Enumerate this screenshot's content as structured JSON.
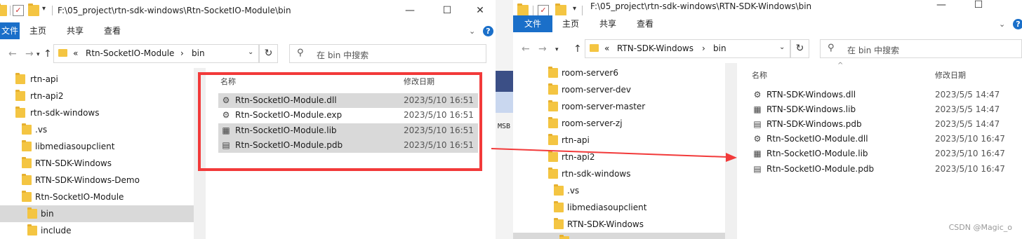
{
  "left_window": {
    "title_path": "F:\\05_project\\rtn-sdk-windows\\Rtn-SocketIO-Module\\bin",
    "controls": {
      "minimize": "—",
      "maximize": "☐",
      "close": "✕"
    },
    "ribbon": {
      "file_tab": "文件",
      "tabs": [
        "主页",
        "共享",
        "查看"
      ]
    },
    "address": {
      "prefix": "«",
      "crumbs": [
        "Rtn-SocketIO-Module",
        "bin"
      ]
    },
    "search_placeholder": "在 bin 中搜索",
    "tree": [
      "rtn-api",
      "rtn-api2",
      "rtn-sdk-windows",
      ".vs",
      "libmediasoupclient",
      "RTN-SDK-Windows",
      "RTN-SDK-Windows-Demo",
      "Rtn-SocketIO-Module",
      "bin",
      "include"
    ],
    "tree_selected": "bin",
    "columns": {
      "name": "名称",
      "date": "修改日期"
    },
    "files": [
      {
        "name": "Rtn-SocketIO-Module.dll",
        "date": "2023/5/10 16:51",
        "icon": "dll-icon"
      },
      {
        "name": "Rtn-SocketIO-Module.exp",
        "date": "2023/5/10 16:51",
        "icon": "exp-icon"
      },
      {
        "name": "Rtn-SocketIO-Module.lib",
        "date": "2023/5/10 16:51",
        "icon": "lib-icon"
      },
      {
        "name": "Rtn-SocketIO-Module.pdb",
        "date": "2023/5/10 16:51",
        "icon": "pdb-icon"
      }
    ]
  },
  "background_window": {
    "text": "MSB"
  },
  "right_window": {
    "title_path": "F:\\05_project\\rtn-sdk-windows\\RTN-SDK-Windows\\bin",
    "controls": {
      "minimize": "—",
      "maximize": "☐"
    },
    "ribbon": {
      "file_tab": "文件",
      "tabs": [
        "主页",
        "共享",
        "查看"
      ]
    },
    "address": {
      "prefix": "«",
      "crumbs": [
        "RTN-SDK-Windows",
        "bin"
      ]
    },
    "search_placeholder": "在 bin 中搜索",
    "tree": [
      "room-server6",
      "room-server-dev",
      "room-server-master",
      "room-server-zj",
      "rtn-api",
      "rtn-api2",
      "rtn-sdk-windows",
      ".vs",
      "libmediasoupclient",
      "RTN-SDK-Windows"
    ],
    "columns": {
      "name": "名称",
      "date": "修改日期"
    },
    "files": [
      {
        "name": "RTN-SDK-Windows.dll",
        "date": "2023/5/5 14:47",
        "icon": "dll-icon"
      },
      {
        "name": "RTN-SDK-Windows.lib",
        "date": "2023/5/5 14:47",
        "icon": "lib-icon"
      },
      {
        "name": "RTN-SDK-Windows.pdb",
        "date": "2023/5/5 14:47",
        "icon": "pdb-icon"
      },
      {
        "name": "Rtn-SocketIO-Module.dll",
        "date": "2023/5/10 16:47",
        "icon": "dll-icon"
      },
      {
        "name": "Rtn-SocketIO-Module.lib",
        "date": "2023/5/10 16:47",
        "icon": "lib-icon"
      },
      {
        "name": "Rtn-SocketIO-Module.pdb",
        "date": "2023/5/10 16:47",
        "icon": "pdb-icon"
      }
    ]
  },
  "annotation": {
    "color": "#f23a3a"
  },
  "watermark": "CSDN @Magic_o"
}
